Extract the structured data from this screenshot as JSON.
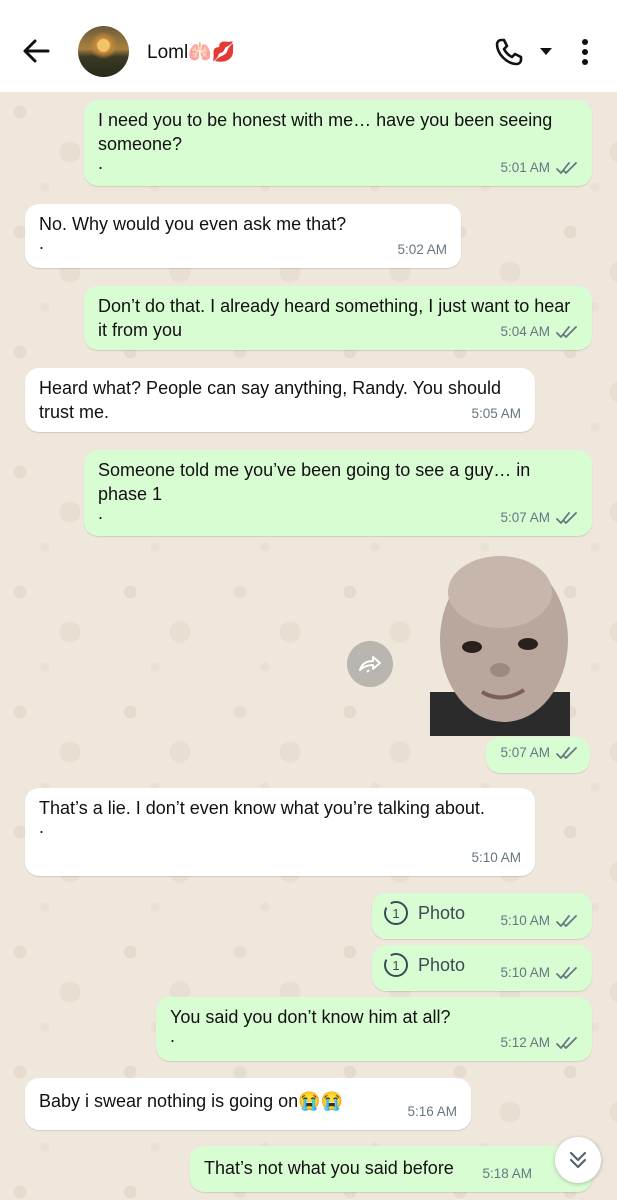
{
  "header": {
    "contact_name": "Loml🫁💋",
    "back_icon": "arrow-left-icon",
    "call_icon": "phone-icon",
    "dropdown_icon": "caret-down-icon",
    "menu_icon": "more-vertical-icon"
  },
  "colors": {
    "outgoing_bubble": "#d9fdd3",
    "incoming_bubble": "#ffffff",
    "wallpaper": "#efe7dc",
    "meta_text": "#667781"
  },
  "messages": [
    {
      "dir": "out",
      "text": "I need you to be honest with me… have you been seeing someone?",
      "extra": ".",
      "time": "5:01 AM",
      "ticks": true
    },
    {
      "dir": "in",
      "text": "No. Why would you even ask me that?",
      "extra": ".",
      "time": "5:02 AM"
    },
    {
      "dir": "out",
      "text": "Don’t do that. I already heard something, I just want to hear it from you",
      "time": "5:04 AM",
      "ticks": true
    },
    {
      "dir": "in",
      "text": "Heard what? People can say anything, Randy. You should trust me.",
      "time": "5:05 AM"
    },
    {
      "dir": "out",
      "text": "Someone told me you’ve been going to see a guy… in phase 1",
      "extra": ".",
      "time": "5:07 AM",
      "ticks": true
    },
    {
      "dir": "out",
      "type": "sticker",
      "time": "5:07 AM",
      "ticks": true
    },
    {
      "dir": "in",
      "text": "That’s a lie. I don’t even know what you’re talking about.",
      "extra": ".",
      "time": "5:10 AM"
    },
    {
      "dir": "out",
      "type": "view-once-photo",
      "label": "Photo",
      "badge": "1",
      "time": "5:10 AM",
      "ticks": true
    },
    {
      "dir": "out",
      "type": "view-once-photo",
      "label": "Photo",
      "badge": "1",
      "time": "5:10 AM",
      "ticks": true
    },
    {
      "dir": "out",
      "text": "You said you don’t know him at all?",
      "extra": ".",
      "time": "5:12 AM",
      "ticks": true
    },
    {
      "dir": "in",
      "text": "Baby i swear nothing is going on😭😭",
      "time": "5:16 AM"
    },
    {
      "dir": "out",
      "text": "That’s not what you said before",
      "time": "5:18 AM",
      "ticks": true
    }
  ]
}
